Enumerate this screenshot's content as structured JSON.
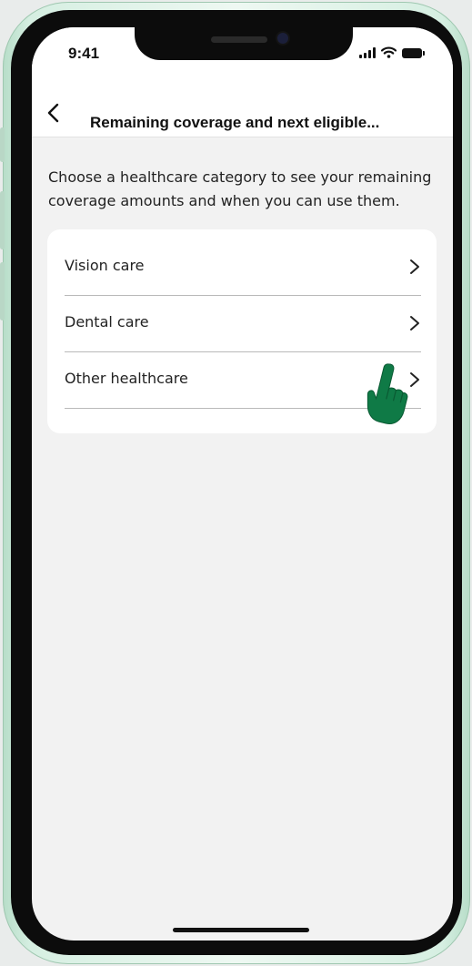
{
  "status_bar": {
    "time": "9:41",
    "icons": [
      "signal-icon",
      "wifi-icon",
      "battery-icon"
    ]
  },
  "header": {
    "back_icon": "chevron-left-icon",
    "title": "Remaining coverage and next eligible..."
  },
  "intro_text": "Choose a healthcare category to see your remaining coverage amounts and when you can use them.",
  "categories": [
    {
      "label": "Vision care",
      "icon": "chevron-right-icon"
    },
    {
      "label": "Dental care",
      "icon": "chevron-right-icon"
    },
    {
      "label": "Other healthcare",
      "icon": "chevron-right-icon"
    }
  ],
  "colors": {
    "screen_background": "#f2f2f2",
    "card_background": "#ffffff",
    "divider": "#b9b9b9",
    "cursor_hand": "#0f7a46",
    "phone_frame": "#d6efe2"
  }
}
